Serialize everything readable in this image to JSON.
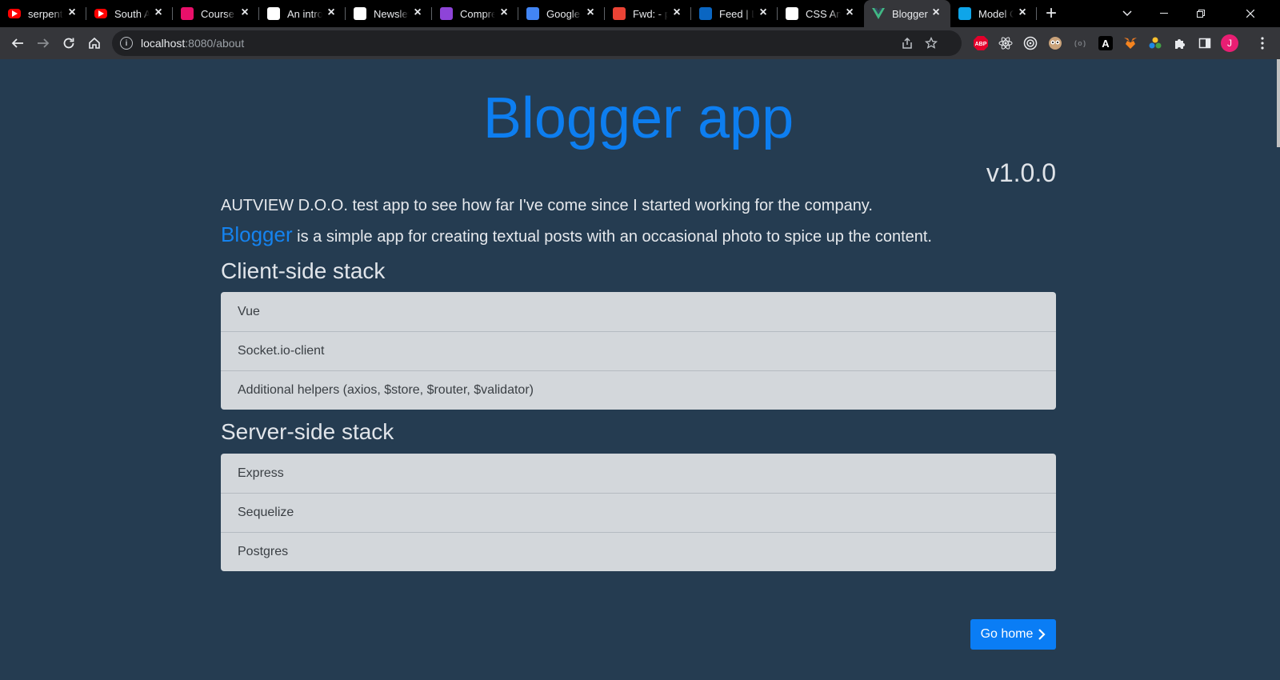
{
  "browser": {
    "tabs": [
      {
        "title": "serpent",
        "favicon": "youtube-icon",
        "color": "#ff0000"
      },
      {
        "title": "South A",
        "favicon": "youtube-icon",
        "color": "#ff0000"
      },
      {
        "title": "Course",
        "favicon": "course-icon",
        "color": "#e8106a"
      },
      {
        "title": "An intro",
        "favicon": "nr-icon",
        "color": "#ffffff"
      },
      {
        "title": "Newslet",
        "favicon": "newsletter-icon",
        "color": "#ffffff"
      },
      {
        "title": "Compre",
        "favicon": "compress-icon",
        "color": "#8e44d8"
      },
      {
        "title": "Google",
        "favicon": "google-translate-icon",
        "color": "#4285f4"
      },
      {
        "title": "Fwd: - p",
        "favicon": "gmail-icon",
        "color": "#ea4335"
      },
      {
        "title": "Feed | L",
        "favicon": "linkedin-icon",
        "color": "#0a66c2"
      },
      {
        "title": "CSS Ani",
        "favicon": "codepen-icon",
        "color": "#ffffff"
      },
      {
        "title": "Blogger",
        "favicon": "vue-icon",
        "color": "#41b883",
        "active": true
      },
      {
        "title": "Model C",
        "favicon": "cube-icon",
        "color": "#0ea5e9"
      }
    ],
    "url_host": "localhost",
    "url_path": ":8080/about",
    "profile_initial": "J",
    "extensions": [
      "adblock-plus-icon",
      "react-devtools-icon",
      "target-icon",
      "owl-icon",
      "bracket-icon",
      "a-icon",
      "metamask-icon",
      "dots-icon",
      "puzzle-icon",
      "sidepanel-icon"
    ]
  },
  "page": {
    "title": "Blogger app",
    "version": "v1.0.0",
    "intro": "AUTVIEW D.O.O. test app to see how far I've come since I started working for the company.",
    "brand": "Blogger",
    "description": " is a simple app for creating textual posts with an occasional photo to spice up the content.",
    "client_heading": "Client-side stack",
    "client_items": [
      "Vue",
      "Socket.io-client",
      "Additional helpers (axios, $store, $router, $validator)"
    ],
    "server_heading": "Server-side stack",
    "server_items": [
      "Express",
      "Sequelize",
      "Postgres"
    ],
    "go_home_label": "Go home"
  },
  "colors": {
    "page_bg": "#253c51",
    "accent": "#0d7ef0",
    "list_bg": "#d3d7db",
    "button": "#0a7df5"
  }
}
